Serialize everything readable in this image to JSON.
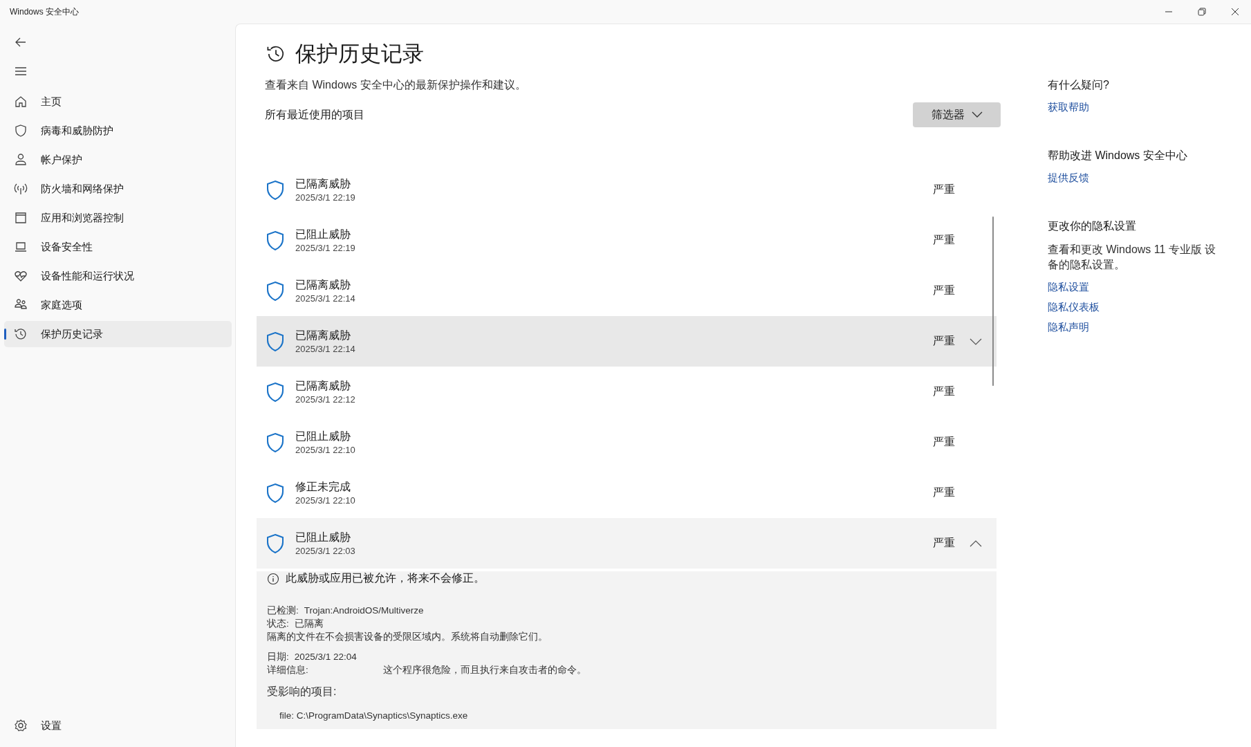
{
  "window": {
    "title": "Windows 安全中心"
  },
  "sidebar": {
    "items": [
      {
        "label": "主页",
        "selected": false
      },
      {
        "label": "病毒和威胁防护",
        "selected": false
      },
      {
        "label": "帐户保护",
        "selected": false
      },
      {
        "label": "防火墙和网络保护",
        "selected": false
      },
      {
        "label": "应用和浏览器控制",
        "selected": false
      },
      {
        "label": "设备安全性",
        "selected": false
      },
      {
        "label": "设备性能和运行状况",
        "selected": false
      },
      {
        "label": "家庭选项",
        "selected": false
      },
      {
        "label": "保护历史记录",
        "selected": true
      }
    ],
    "settings": "设置"
  },
  "page": {
    "title": "保护历史记录",
    "subtitle": "查看来自 Windows 安全中心的最新保护操作和建议。",
    "section": "所有最近使用的项目",
    "filter_button": "筛选器"
  },
  "history": [
    {
      "title": "已隔离威胁",
      "date": "2025/3/1 22:19",
      "severity": "严重",
      "highlighted": false,
      "expanded": false
    },
    {
      "title": "已阻止威胁",
      "date": "2025/3/1 22:19",
      "severity": "严重",
      "highlighted": false,
      "expanded": false
    },
    {
      "title": "已隔离威胁",
      "date": "2025/3/1 22:14",
      "severity": "严重",
      "highlighted": false,
      "expanded": false
    },
    {
      "title": "已隔离威胁",
      "date": "2025/3/1 22:14",
      "severity": "严重",
      "highlighted": true,
      "expanded": false
    },
    {
      "title": "已隔离威胁",
      "date": "2025/3/1 22:12",
      "severity": "严重",
      "highlighted": false,
      "expanded": false
    },
    {
      "title": "已阻止威胁",
      "date": "2025/3/1 22:10",
      "severity": "严重",
      "highlighted": false,
      "expanded": false
    },
    {
      "title": "修正未完成",
      "date": "2025/3/1 22:10",
      "severity": "严重",
      "highlighted": false,
      "expanded": false
    },
    {
      "title": "已阻止威胁",
      "date": "2025/3/1 22:03",
      "severity": "严重",
      "highlighted": false,
      "expanded": true
    }
  ],
  "details": {
    "notice": "此威胁或应用已被允许，将来不会修正。",
    "detected_label": "已检测:",
    "detected_value": "Trojan:AndroidOS/Multiverze",
    "status_label": "状态:",
    "status_value": "已隔离",
    "description": "隔离的文件在不会损害设备的受限区域内。系统将自动删除它们。",
    "date_label": "日期:",
    "date_value": "2025/3/1 22:04",
    "info_label": "详细信息:",
    "info_value": "这个程序很危险，而且执行来自攻击者的命令。",
    "affected_heading": "受影响的项目:",
    "affected_item": "file: C:\\ProgramData\\Synaptics\\Synaptics.exe"
  },
  "help": [
    {
      "heading": "有什么疑问?",
      "links": [
        "获取帮助"
      ]
    },
    {
      "heading": "帮助改进 Windows 安全中心",
      "links": [
        "提供反馈"
      ]
    },
    {
      "heading": "更改你的隐私设置",
      "text": "查看和更改 Windows 11 专业版 设备的隐私设置。",
      "links": [
        "隐私设置",
        "隐私仪表板",
        "隐私声明"
      ]
    }
  ]
}
